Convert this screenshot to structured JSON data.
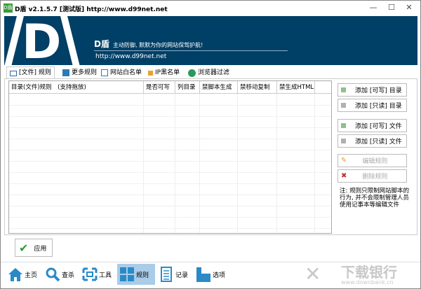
{
  "window": {
    "title": "D盾 v2.1.5.7 [测试版] http://www.d99net.net",
    "icon_text": "D盾",
    "minimize": "—",
    "maximize": "☐",
    "close": "✕"
  },
  "banner": {
    "logo_letter": "D",
    "brand": "D盾",
    "slogan": "主动防御, 默默为你的网站保驾护航!",
    "url": "http://www.d99net.net"
  },
  "tabs": [
    {
      "label": "[文件] 规则",
      "icon": "folder-icon",
      "active": true
    },
    {
      "label": "更多规则",
      "icon": "more-rules-icon"
    },
    {
      "label": "网站白名单",
      "icon": "whitelist-icon"
    },
    {
      "label": "IP黑名单",
      "icon": "ip-blacklist-icon"
    },
    {
      "label": "浏览器过滤",
      "icon": "globe-icon"
    }
  ],
  "table": {
    "columns": [
      "目录(文件)规则　(支持拖放)",
      "是否可写",
      "列目录",
      "禁脚本生成",
      "禁移动复制",
      "禁生成HTML"
    ],
    "rows": []
  },
  "actions": [
    {
      "label": "添加 [可写] 目录",
      "color": "#8fc08f",
      "enabled": true
    },
    {
      "label": "添加 [只读] 目录",
      "color": "#b0b0b0",
      "enabled": true
    },
    {
      "label": "添加 [可写] 文件",
      "color": "#8fc08f",
      "enabled": true
    },
    {
      "label": "添加 [只读] 文件",
      "color": "#b0b0b0",
      "enabled": true
    },
    {
      "label": "编辑规则",
      "icon": "pencil-icon",
      "enabled": false
    },
    {
      "label": "删除规则",
      "icon": "delete-icon",
      "enabled": false
    }
  ],
  "note": "注: 规则只限制网站脚本的行为, 并不会限制管理人员使用记事本等编辑文件",
  "apply_label": "应用",
  "nav": [
    {
      "label": "主页",
      "icon": "home-icon"
    },
    {
      "label": "查杀",
      "icon": "search-icon"
    },
    {
      "label": "工具",
      "icon": "tools-icon"
    },
    {
      "label": "规则",
      "icon": "rules-icon",
      "active": true
    },
    {
      "label": "记录",
      "icon": "log-icon"
    },
    {
      "label": "选项",
      "icon": "options-icon"
    }
  ],
  "watermark": {
    "name": "下载银行",
    "url": "www.downbank.cn"
  },
  "colors": {
    "banner": "#003f66",
    "accent": "#2a8ac8",
    "nav_active": "#a9cce8"
  }
}
